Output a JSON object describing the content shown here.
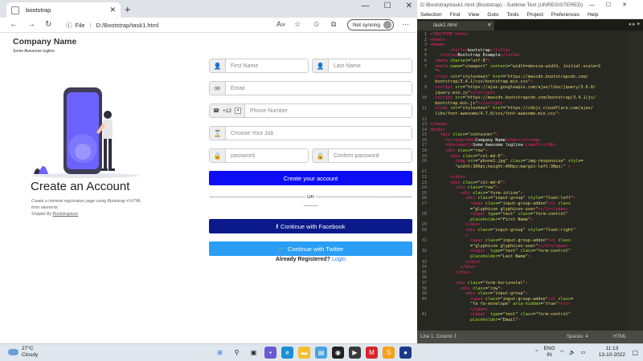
{
  "browser": {
    "tab_title": "bootstrap",
    "url_label": "File",
    "url": "D:/Bootstrap/task1.html",
    "sync_label": "Not syncing"
  },
  "page": {
    "company": "Company Name",
    "tagline": "Some Awesome logline",
    "hero_title": "Create an Account",
    "hero_desc": "Create a minimal registration page using Bootstrap 4 HTML form elements.",
    "snippet_label": "Snippet By ",
    "snippet_author": "Bootstrapious",
    "form": {
      "first_name": "First Name",
      "last_name": "Last Name",
      "email": "Email",
      "phone_code": "+12",
      "phone": "Phone Number",
      "job": "Choose Your Job",
      "password": "password",
      "confirm": "Confirm password",
      "create_btn": "Create your account",
      "or_text": "------------------------------------------------------------ OR ------------------------------------------------------------",
      "or_text2": "---------",
      "fb_btn": "Continue with Facebook",
      "tw_btn": "Continue with Twitter",
      "already": "Already Registered?",
      "login": "Login"
    }
  },
  "editor": {
    "title": "D:\\Bootstrap\\task1.html (Bootstrap) - Sublime Text (UNREGISTERED)",
    "menu": [
      "Selection",
      "Find",
      "View",
      "Goto",
      "Tools",
      "Project",
      "Preferences",
      "Help"
    ],
    "tab": "task1.html",
    "status_left": "Line 1, Column 1",
    "status_spaces": "Spaces: 4",
    "status_lang": "HTML",
    "lines": [
      {
        "n": "1",
        "html": "<span class='t'>&lt;!DOCTYPE html&gt;</span>"
      },
      {
        "n": "2",
        "html": "<span class='t'>&lt;html&gt;</span>"
      },
      {
        "n": "3",
        "html": "<span class='t'>&lt;head&gt;</span>"
      },
      {
        "n": "4",
        "html": "        <span class='t'>&lt;title&gt;</span>bootstrap<span class='t'>&lt;/title&gt;</span>"
      },
      {
        "n": "5",
        "html": "    <span class='t'>&lt;title&gt;</span>Bootstrap Example<span class='t'>&lt;/title&gt;</span>"
      },
      {
        "n": "6",
        "html": "  <span class='t'>&lt;meta</span> <span class='a'>charset</span>=<span class='s'>\"utf-8\"</span><span class='t'>&gt;</span>"
      },
      {
        "n": "7",
        "html": "  <span class='t'>&lt;meta</span> <span class='a'>name</span>=<span class='s'>\"viewport\"</span> <span class='a'>content</span>=<span class='s'>\"width=device-width, initial-scale=1</span>"
      },
      {
        "n": "",
        "html": "  <span class='s'>\"</span><span class='t'>&gt;</span>"
      },
      {
        "n": "8",
        "html": "  <span class='t'>&lt;link</span> <span class='a'>rel</span>=<span class='s'>\"stylesheet\"</span> <span class='a'>href</span>=<span class='s'>\"https://maxcdn.bootstrapcdn.com/</span>"
      },
      {
        "n": "",
        "html": "  <span class='s'>bootstrap/3.4.1/css/bootstrap.min.css\"</span><span class='t'>&gt;</span>"
      },
      {
        "n": "9",
        "html": "  <span class='t'>&lt;script</span> <span class='a'>src</span>=<span class='s'>\"https://ajax.googleapis.com/ajax/libs/jquery/3.6.0/</span>"
      },
      {
        "n": "",
        "html": "  <span class='s'>jquery.min.js\"</span><span class='t'>&gt;&lt;/script&gt;</span>"
      },
      {
        "n": "10",
        "html": "  <span class='t'>&lt;script</span> <span class='a'>src</span>=<span class='s'>\"https://maxcdn.bootstrapcdn.com/bootstrap/3.4.1/js/</span>"
      },
      {
        "n": "",
        "html": "  <span class='s'>bootstrap.min.js\"</span><span class='t'>&gt;&lt;/script&gt;</span>"
      },
      {
        "n": "11",
        "html": "  <span class='t'>&lt;link</span> <span class='a'>rel</span>=<span class='s'>\"stylesheet\"</span> <span class='a'>href</span>=<span class='s'>\"https://cdnjs.cloudflare.com/ajax/</span>"
      },
      {
        "n": "",
        "html": "  <span class='s'>libs/font-awesome/4.7.0/css/font-awesome.min.css\"</span><span class='t'>&gt;</span>"
      },
      {
        "n": "12",
        "html": ""
      },
      {
        "n": "13",
        "html": "<span class='t'>&lt;/head&gt;</span>"
      },
      {
        "n": "14",
        "html": "<span class='t'>&lt;body&gt;</span>"
      },
      {
        "n": "15",
        "html": "    <span class='t'>&lt;div</span> <span class='a'>class</span>=<span class='s'>\"container\"</span><span class='t'>&gt;</span>"
      },
      {
        "n": "16",
        "html": "      <span class='t'>&lt;strong&gt;&lt;h4&gt;</span>Company Name<span class='t'>&lt;/h4&gt;&lt;/strong&gt;</span>"
      },
      {
        "n": "17",
        "html": "      <span class='t'>&lt;h6&gt;&lt;small&gt;</span>Some Awesome logline<span class='t'>&lt;/small&gt;&lt;/h6&gt;</span>"
      },
      {
        "n": "18",
        "html": "      <span class='t'>&lt;div</span> <span class='a'>class</span>=<span class='s'>\"row\"</span><span class='t'>&gt;</span>"
      },
      {
        "n": "19",
        "html": "        <span class='t'>&lt;div</span> <span class='a'>class</span>=<span class='s'>\"col-md-6\"</span><span class='t'>&gt;</span>"
      },
      {
        "n": "20",
        "html": "          <span class='t'>&lt;img</span> <span class='a'>src</span>=<span class='s'>\"phone1.jpg\"</span> <span class='a'>class</span>=<span class='s'>\"img-responsive\"</span> <span class='a'>style</span>=</span>"
      },
      {
        "n": "",
        "html": "          <span class='s'>\"width:300px;height:400px;margin-left:30px;\"</span> <span class='t'>&gt;</span>"
      },
      {
        "n": "21",
        "html": ""
      },
      {
        "n": "22",
        "html": "        <span class='t'>&lt;/div&gt;</span>"
      },
      {
        "n": "23",
        "html": "        <span class='t'>&lt;div</span> <span class='a'>class</span>=<span class='s'>\"col-md-6\"</span><span class='t'>&gt;</span>"
      },
      {
        "n": "24",
        "html": "          <span class='t'>&lt;div</span> <span class='a'>class</span>=<span class='s'>\"row\"</span><span class='t'>&gt;</span>"
      },
      {
        "n": "25",
        "html": "            <span class='t'>&lt;div</span> <span class='a'>class</span>=<span class='s'>\"form-inline\"</span><span class='t'>&gt;</span>"
      },
      {
        "n": "26",
        "html": "              <span class='t'>&lt;div</span> <span class='a'>class</span>=<span class='s'>\"input-group\"</span> <span class='a'>style</span>=<span class='s'>\"float:left\"</span><span class='t'>&gt;</span>"
      },
      {
        "n": "27",
        "html": "                <span class='t'>&lt;span</span> <span class='a'>class</span>=<span class='s'>\"input-group-addon\"</span><span class='t'>&gt;&lt;i</span> <span class='a'>class</span>"
      },
      {
        "n": "",
        "html": "                =<span class='s'>\"glyphicon glyphicon-user\"</span><span class='t'>&gt;&lt;/i&gt;&lt;/span&gt;</span>"
      },
      {
        "n": "28",
        "html": "                <span class='t'>&lt;input</span> <span class='a'>type</span>=<span class='s'>\"text\"</span> <span class='a'>class</span>=<span class='s'>\"form-control\"</span>"
      },
      {
        "n": "",
        "html": "                <span class='a'>placeholder</span>=<span class='s'>\"First Name\"</span><span class='t'>&gt;</span>"
      },
      {
        "n": "29",
        "html": "              <span class='t'>&lt;/div&gt;</span>"
      },
      {
        "n": "30",
        "html": "              <span class='t'>&lt;div</span> <span class='a'>class</span>=<span class='s'>\"input-group\"</span> <span class='a'>style</span>=<span class='s'>\"float:right\"</span>"
      },
      {
        "n": "",
        "html": "              <span class='t'>&gt;</span>"
      },
      {
        "n": "31",
        "html": "                <span class='t'>&lt;span</span> <span class='a'>class</span>=<span class='s'>\"input-group-addon\"</span><span class='t'>&gt;&lt;i</span> <span class='a'>class</span>"
      },
      {
        "n": "",
        "html": "                =<span class='s'>\"glyphicon glyphicon-user\"</span><span class='t'>&gt;&lt;/i&gt;&lt;/span&gt;</span>"
      },
      {
        "n": "32",
        "html": "                <span class='t'>&lt;input</span>  <span class='a'>type</span>=<span class='s'>\"text\"</span> <span class='a'>class</span>=<span class='s'>\"form-control\"</span>"
      },
      {
        "n": "",
        "html": "                <span class='a'>placeholder</span>=<span class='s'>\"Last Name\"</span><span class='t'>&gt;</span>"
      },
      {
        "n": "33",
        "html": "              <span class='t'>&lt;/div&gt;</span>"
      },
      {
        "n": "34",
        "html": "            <span class='t'>&lt;/div&gt;</span>"
      },
      {
        "n": "35",
        "html": "          <span class='t'>&lt;/div&gt;</span>"
      },
      {
        "n": "36",
        "html": ""
      },
      {
        "n": "37",
        "html": "          <span class='t'>&lt;div</span> <span class='a'>class</span>=<span class='s'>\"form-horizontal\"</span><span class='t'>&gt;</span>"
      },
      {
        "n": "38",
        "html": "            <span class='t'>&lt;div</span> <span class='a'>class</span>=<span class='s'>\"row\"</span><span class='t'>&gt;</span>"
      },
      {
        "n": "39",
        "html": "              <span class='t'>&lt;div</span> <span class='a'>class</span>=<span class='s'>\"input-group\"</span><span class='t'>&gt;</span>"
      },
      {
        "n": "40",
        "html": "                <span class='t'>&lt;span</span> <span class='a'>class</span>=<span class='s'>\"input-group-addon\"</span><span class='t'>&gt;&lt;i</span> <span class='a'>class</span>="
      },
      {
        "n": "",
        "html": "                <span class='s'>\"fa fa-envelope\"</span> <span class='a'>aria-hidden</span>=<span class='s'>\"true\"</span><span class='t'>&gt;&lt;/i&gt;</span>"
      },
      {
        "n": "",
        "html": "                <span class='t'>&lt;/span&gt;</span>"
      },
      {
        "n": "41",
        "html": "                <span class='t'>&lt;input</span>  <span class='a'>type</span>=<span class='s'>\"text\"</span> <span class='a'>class</span>=<span class='s'>\"form-control\"</span>"
      },
      {
        "n": "",
        "html": "                <span class='a'>placeholder</span>=<span class='s'>\"Email\"</span><span class='t'>&gt;</span>"
      }
    ]
  },
  "taskbar": {
    "temp": "27°C",
    "weather": "Cloudy",
    "lang1": "ENG",
    "lang2": "IN",
    "time": "11:13",
    "date": "13-10-2022"
  }
}
